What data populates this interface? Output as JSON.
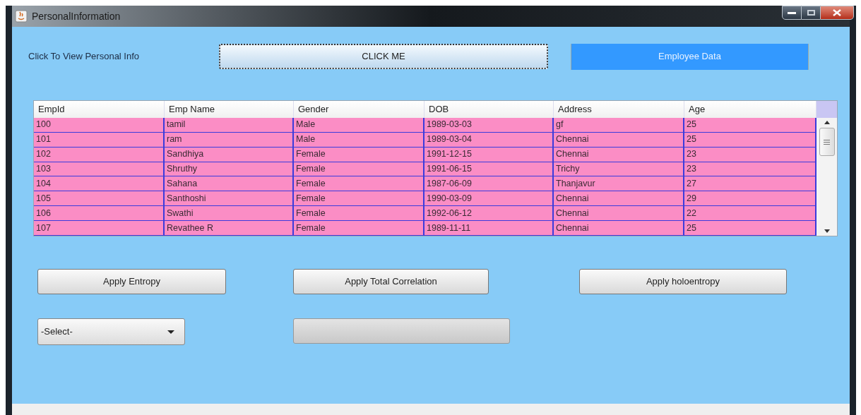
{
  "window": {
    "title": "PersonalInformation"
  },
  "prompt_label": "Click To View Personal Info",
  "click_button": {
    "label": "CLICK ME",
    "focused": true
  },
  "employee_data_button": {
    "label": "Employee Data"
  },
  "table": {
    "columns": [
      "EmpId",
      "Emp Name",
      "Gender",
      "DOB",
      "Address",
      "Age"
    ],
    "rows": [
      [
        "100",
        "tamil",
        "Male",
        "1989-03-03",
        "gf",
        "25"
      ],
      [
        "101",
        "ram",
        "Male",
        "1989-03-04",
        "Chennai",
        "25"
      ],
      [
        "102",
        "Sandhiya",
        "Female",
        "1991-12-15",
        "Chennai",
        "23"
      ],
      [
        "103",
        "Shruthy",
        "Female",
        "1991-06-15",
        "Trichy",
        "23"
      ],
      [
        "104",
        "Sahana",
        "Female",
        "1987-06-09",
        "Thanjavur",
        "27"
      ],
      [
        "105",
        "Santhoshi",
        "Female",
        "1990-03-09",
        "Chennai",
        "29"
      ],
      [
        "106",
        "Swathi",
        "Female",
        "1992-06-12",
        "Chennai",
        "22"
      ],
      [
        "107",
        "Revathee R",
        "Female",
        "1989-11-11",
        "Chennai",
        "25"
      ]
    ]
  },
  "action_buttons": [
    "Apply Entropy",
    "Apply Total Correlation",
    "Apply holoentropy"
  ],
  "select": {
    "value": "-Select-"
  }
}
